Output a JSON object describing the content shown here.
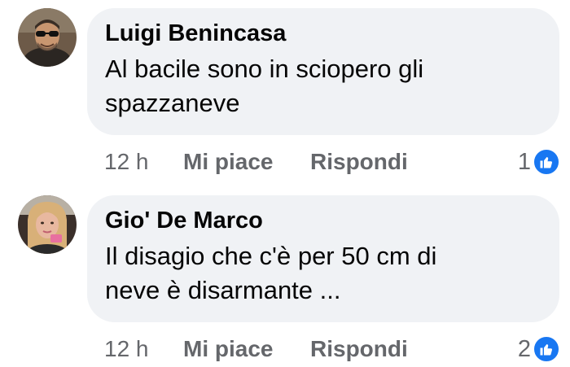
{
  "comments": [
    {
      "author": "Luigi Benincasa",
      "text_lines": [
        "Al bacile sono in sciopero gli",
        "spazzaneve"
      ],
      "time": "12 h",
      "like_label": "Mi piace",
      "reply_label": "Rispondi",
      "reaction_count": "1",
      "reaction_icon": "thumbs-up-icon"
    },
    {
      "author": "Gio' De Marco",
      "text_lines": [
        "Il disagio che c'è per 50 cm di",
        "neve è disarmante ..."
      ],
      "time": "12 h",
      "like_label": "Mi piace",
      "reply_label": "Rispondi",
      "reaction_count": "2",
      "reaction_icon": "thumbs-up-icon"
    }
  ],
  "colors": {
    "bubble_bg": "#f0f2f5",
    "meta_text": "#65676b",
    "like_blue": "#1877f2"
  }
}
